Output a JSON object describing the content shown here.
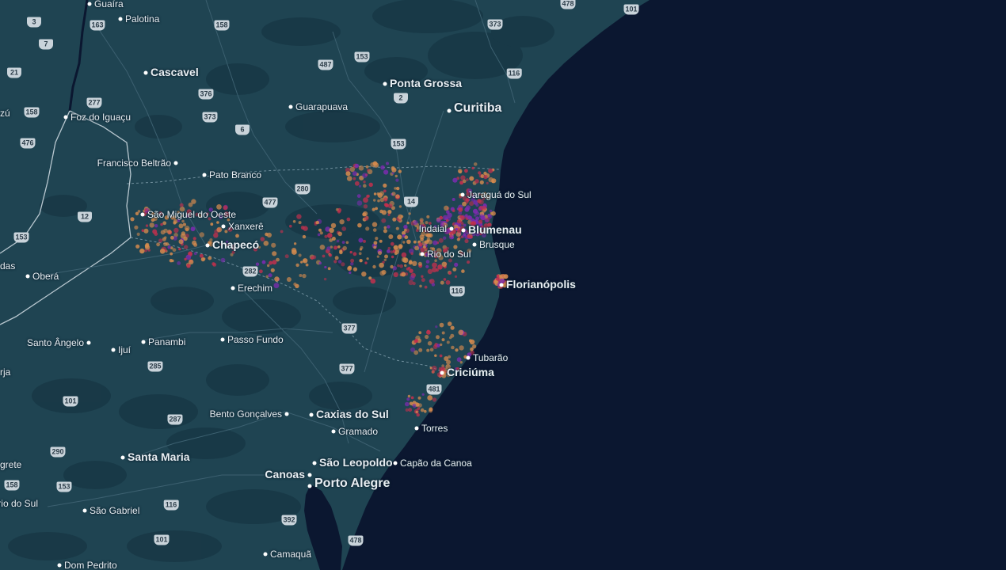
{
  "map": {
    "cities": [
      {
        "id": "guaira",
        "name": "Guaíra",
        "size": "normal"
      },
      {
        "id": "palotina",
        "name": "Palotina",
        "size": "normal"
      },
      {
        "id": "cascavel",
        "name": "Cascavel",
        "size": "major"
      },
      {
        "id": "foz-do-iguacu",
        "name": "Foz do Iguaçu",
        "size": "normal"
      },
      {
        "id": "ponta-grossa",
        "name": "Ponta Grossa",
        "size": "major"
      },
      {
        "id": "guarapuava",
        "name": "Guarapuava",
        "size": "normal"
      },
      {
        "id": "curitiba",
        "name": "Curitiba",
        "size": "large"
      },
      {
        "id": "francisco-beltrao",
        "name": "Francisco Beltrão",
        "size": "normal"
      },
      {
        "id": "pato-branco",
        "name": "Pato Branco",
        "size": "normal"
      },
      {
        "id": "jaragua-do-sul",
        "name": "Jaraguá do Sul",
        "size": "normal"
      },
      {
        "id": "sao-miguel-do-oeste",
        "name": "São Miguel do Oeste",
        "size": "normal"
      },
      {
        "id": "xanxere",
        "name": "Xanxerê",
        "size": "normal"
      },
      {
        "id": "indaial",
        "name": "Indaial",
        "size": "normal"
      },
      {
        "id": "blumenau",
        "name": "Blumenau",
        "size": "major"
      },
      {
        "id": "brusque",
        "name": "Brusque",
        "size": "normal"
      },
      {
        "id": "chapeco",
        "name": "Chapecó",
        "size": "major"
      },
      {
        "id": "rio-do-sul",
        "name": "Rio do Sul",
        "size": "normal"
      },
      {
        "id": "obera",
        "name": "Oberá",
        "size": "normal"
      },
      {
        "id": "florianopolis",
        "name": "Florianópolis",
        "size": "major"
      },
      {
        "id": "erechim",
        "name": "Erechim",
        "size": "normal"
      },
      {
        "id": "santo-angelo",
        "name": "Santo Ângelo",
        "size": "normal"
      },
      {
        "id": "ijui",
        "name": "Ijuí",
        "size": "normal"
      },
      {
        "id": "panambi",
        "name": "Panambi",
        "size": "normal"
      },
      {
        "id": "passo-fundo",
        "name": "Passo Fundo",
        "size": "normal"
      },
      {
        "id": "tubarao",
        "name": "Tubarão",
        "size": "normal"
      },
      {
        "id": "criciuma",
        "name": "Criciúma",
        "size": "major"
      },
      {
        "id": "bento-goncalves",
        "name": "Bento Gonçalves",
        "size": "normal"
      },
      {
        "id": "caxias-do-sul",
        "name": "Caxias do Sul",
        "size": "major"
      },
      {
        "id": "gramado",
        "name": "Gramado",
        "size": "normal"
      },
      {
        "id": "torres",
        "name": "Torres",
        "size": "normal"
      },
      {
        "id": "santa-maria",
        "name": "Santa Maria",
        "size": "major"
      },
      {
        "id": "sao-leopoldo",
        "name": "São Leopoldo",
        "size": "major"
      },
      {
        "id": "capao-da-canoa",
        "name": "Capão da Canoa",
        "size": "normal"
      },
      {
        "id": "canoas",
        "name": "Canoas",
        "size": "major"
      },
      {
        "id": "porto-alegre",
        "name": "Porto Alegre",
        "size": "large"
      },
      {
        "id": "sao-gabriel",
        "name": "São Gabriel",
        "size": "normal"
      },
      {
        "id": "camaqua",
        "name": "Camaquã",
        "size": "normal"
      },
      {
        "id": "dom-pedrito",
        "name": "Dom Pedrito",
        "size": "normal"
      },
      {
        "id": "partial-azu",
        "name": "zú",
        "size": "normal"
      },
      {
        "id": "partial-das",
        "name": "das",
        "size": "normal"
      },
      {
        "id": "partial-rja",
        "name": "rja",
        "size": "normal"
      },
      {
        "id": "partial-egrete",
        "name": "grete",
        "size": "normal"
      },
      {
        "id": "partial-rio-do-sul",
        "name": "rio do Sul",
        "size": "normal"
      }
    ],
    "roads": [
      "3",
      "163",
      "158",
      "478",
      "101",
      "373",
      "7",
      "487",
      "153",
      "21",
      "277",
      "116",
      "376",
      "2",
      "158",
      "373",
      "6",
      "476",
      "153",
      "280",
      "477",
      "14",
      "12",
      "153",
      "282",
      "116",
      "377",
      "285",
      "377",
      "101",
      "481",
      "287",
      "290",
      "158",
      "153",
      "116",
      "392",
      "101",
      "478"
    ],
    "colors": {
      "ocean": "#0b1730",
      "land": "#1f4452",
      "heat_low": "#d48a4e",
      "heat_mid": "#c2304d",
      "heat_high": "#7d2bb0"
    }
  }
}
